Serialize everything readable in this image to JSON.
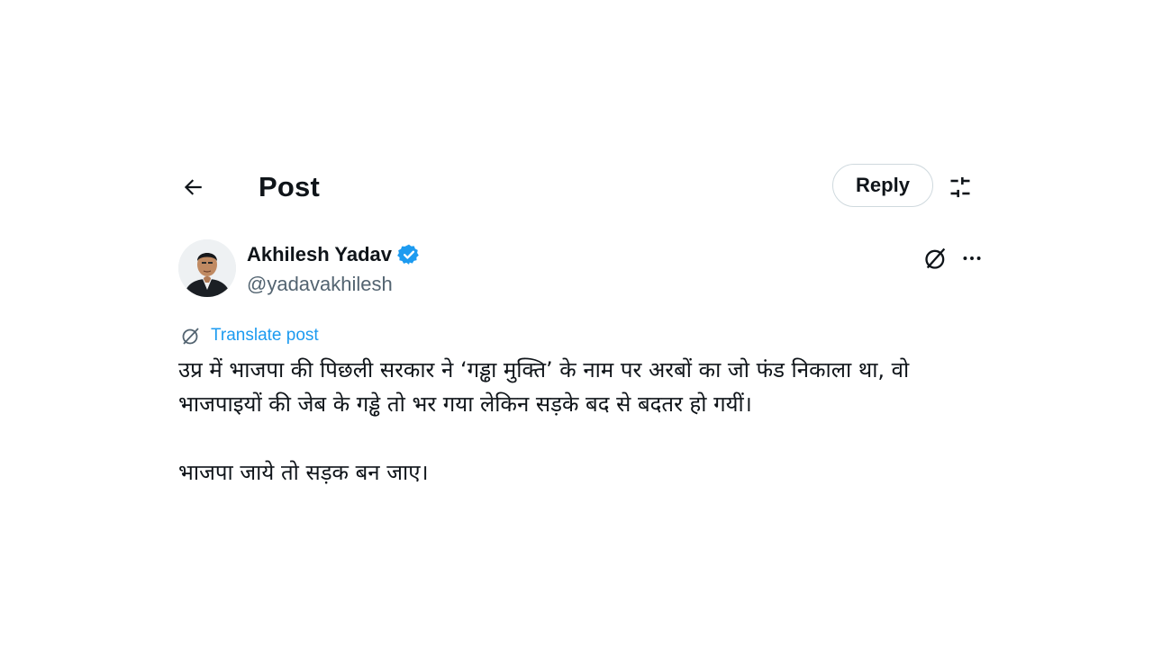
{
  "header": {
    "title": "Post",
    "reply_label": "Reply"
  },
  "author": {
    "name": "Akhilesh Yadav",
    "handle": "@yadavakhilesh",
    "verified": true
  },
  "translate": {
    "label": "Translate post"
  },
  "post": {
    "paragraphs": [
      "उप्र में भाजपा की पिछली सरकार ने ‘गड्ढा मुक्ति’ के नाम पर अरबों का जो फंड निकाला था, वो भाजपाइयों की जेब के गड्ढे तो भर गया लेकिन सड़के बद से बदतर हो गयीं।",
      "भाजपा जाये तो सड़क बन जाए।"
    ]
  },
  "colors": {
    "text": "#0f1419",
    "secondary": "#536471",
    "accent": "#1d9bf0",
    "border": "#cfd9de"
  },
  "icons": {
    "back": "arrow-left-icon",
    "settings": "sliders-icon",
    "verified": "verified-badge-icon",
    "grok": "grok-icon",
    "more": "more-icon",
    "translate": "translate-icon"
  }
}
